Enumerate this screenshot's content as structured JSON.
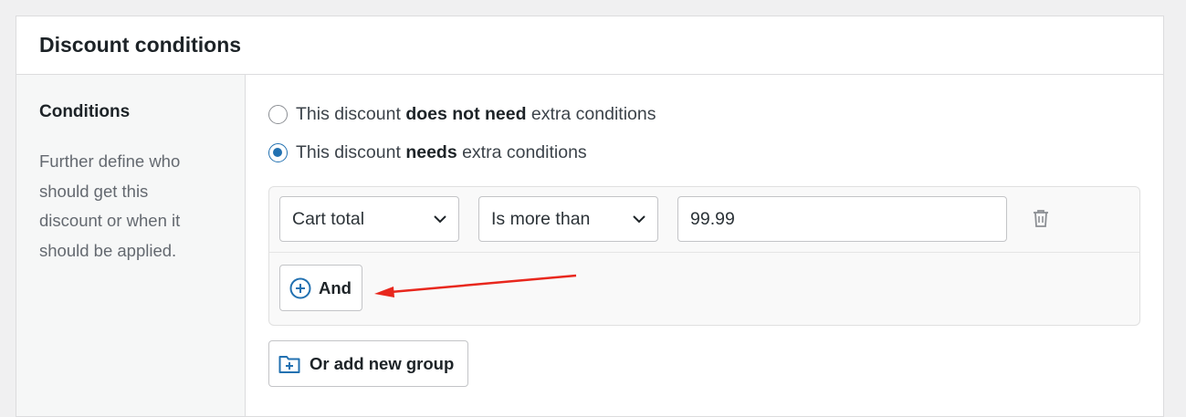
{
  "panel": {
    "title": "Discount conditions"
  },
  "sidebar": {
    "heading": "Conditions",
    "description": "Further define who should get this discount or when it should be applied."
  },
  "radios": [
    {
      "prefix": "This discount ",
      "bold": "does not need",
      "suffix": " extra conditions",
      "checked": false
    },
    {
      "prefix": "This discount ",
      "bold": "needs",
      "suffix": " extra conditions",
      "checked": true
    }
  ],
  "condition": {
    "field": "Cart total",
    "operator": "Is more than",
    "value": "99.99"
  },
  "buttons": {
    "and_label": "And",
    "add_group_label": "Or add new group"
  },
  "icons": {
    "chevron": "chevron-down-icon",
    "trash": "trash-icon",
    "plus_circle": "plus-circle-icon",
    "folder_plus": "folder-plus-icon",
    "annotation_arrow": "arrow-icon"
  },
  "colors": {
    "accent": "#2271b1",
    "annotation": "#e8271d"
  }
}
